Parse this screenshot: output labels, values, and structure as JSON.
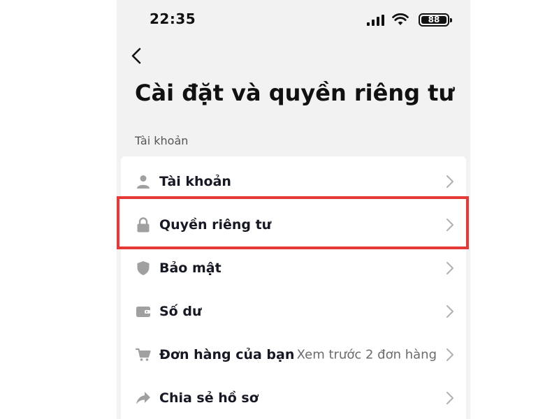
{
  "status_bar": {
    "time": "22:35",
    "battery": "88",
    "icons": [
      "signal-icon",
      "wifi-icon",
      "battery-icon"
    ]
  },
  "header": {
    "back_icon": "back-chevron-icon",
    "title": "Cài đặt và quyền riêng tư"
  },
  "section": {
    "title": "Tài khoản"
  },
  "items": [
    {
      "label": "Tài khoản",
      "icon": "person-icon",
      "value": ""
    },
    {
      "label": "Quyền riêng tư",
      "icon": "lock-icon",
      "value": ""
    },
    {
      "label": "Bảo mật",
      "icon": "shield-icon",
      "value": ""
    },
    {
      "label": "Số dư",
      "icon": "wallet-icon",
      "value": ""
    },
    {
      "label": "Đơn hàng của bạn",
      "icon": "cart-icon",
      "value": "Xem trước 2 đơn hàng"
    },
    {
      "label": "Chia sẻ hồ sơ",
      "icon": "share-icon",
      "value": ""
    }
  ],
  "colors": {
    "background": "#f2f2f2",
    "card": "#ffffff",
    "highlight": "#e53935",
    "icon": "#a0a0a0",
    "chevron": "#b0b0b0"
  }
}
